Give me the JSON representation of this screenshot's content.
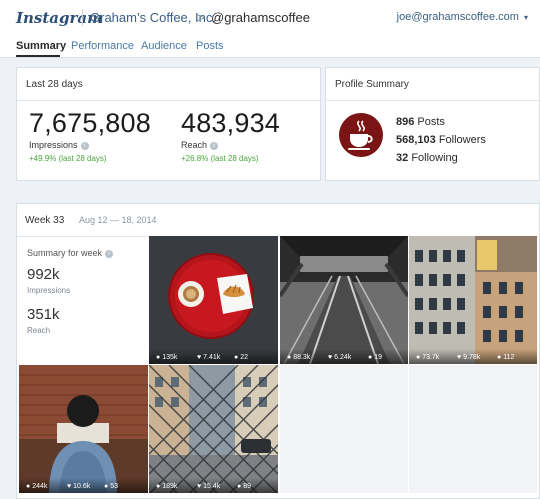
{
  "header": {
    "logo": "Instagram",
    "company": "Graham’s Coffee, Inc.",
    "breadcrumb_sep": ">",
    "handle": "@grahamscoffee",
    "account": "joe@grahamscoffee.com",
    "account_caret": "▾"
  },
  "tabs": [
    {
      "label": "Summary"
    },
    {
      "label": "Performance"
    },
    {
      "label": "Audience"
    },
    {
      "label": "Posts"
    }
  ],
  "overview": {
    "title": "Last 28 days",
    "impressions": {
      "value": "7,675,808",
      "label": "Impressions",
      "change": "+49.9% (last 28 days)"
    },
    "reach": {
      "value": "483,934",
      "label": "Reach",
      "change": "+26.8% (last 28 days)"
    }
  },
  "profile": {
    "title": "Profile Summary",
    "posts": {
      "count": "896",
      "label": "Posts"
    },
    "followers": {
      "count": "568,103",
      "label": "Followers"
    },
    "following": {
      "count": "32",
      "label": "Following"
    }
  },
  "week": {
    "label": "Week 33",
    "range": "Aug 12 — 18, 2014",
    "summary_title": "Summary for week",
    "impressions": {
      "value": "992k",
      "label": "Impressions"
    },
    "reach": {
      "value": "351k",
      "label": "Reach"
    }
  },
  "posts": [
    {
      "views": "135k",
      "likes": "7.41k",
      "comments": "22"
    },
    {
      "views": "88.3k",
      "likes": "6.24k",
      "comments": "19"
    },
    {
      "views": "73.7k",
      "likes": "9.78k",
      "comments": "112"
    },
    {
      "views": "244k",
      "likes": "10.6k",
      "comments": "53"
    },
    {
      "views": "189k",
      "likes": "15.4k",
      "comments": "89"
    }
  ],
  "icons": {
    "views": "eye-icon",
    "likes": "heart-icon",
    "comments": "comment-icon",
    "info": "info-icon"
  },
  "colors": {
    "brand": "#2a4f78",
    "positive": "#4aa33b",
    "avatar": "#7b1414"
  }
}
